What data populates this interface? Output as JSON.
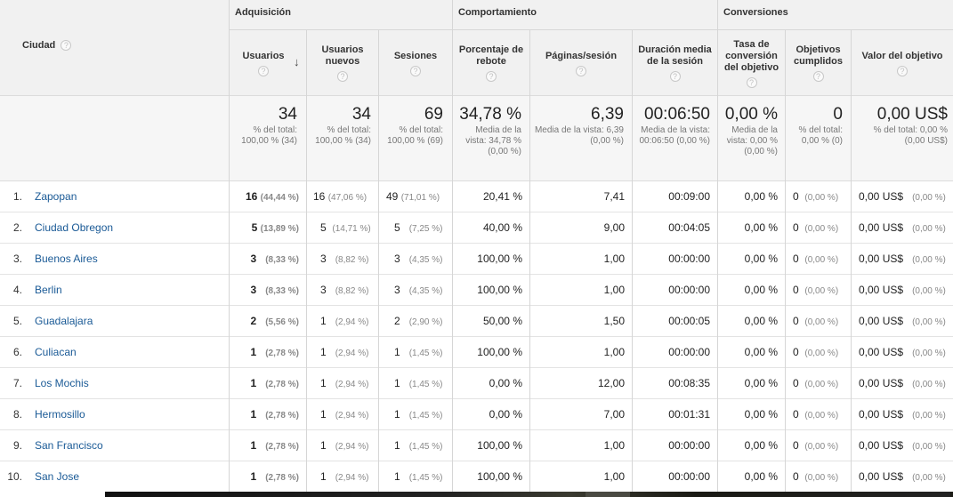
{
  "header": {
    "city_label": "Ciudad",
    "help_glyph": "?",
    "groups": [
      {
        "label": "Adquisición"
      },
      {
        "label": "Comportamiento"
      },
      {
        "label": "Conversiones"
      }
    ],
    "columns": [
      {
        "label": "Usuarios"
      },
      {
        "label": "Usuarios nuevos"
      },
      {
        "label": "Sesiones"
      },
      {
        "label": "Porcentaje de rebote"
      },
      {
        "label": "Páginas/sesión"
      },
      {
        "label": "Duración media de la sesión"
      },
      {
        "label": "Tasa de conversión del objetivo"
      },
      {
        "label": "Objetivos cumplidos"
      },
      {
        "label": "Valor del objetivo"
      }
    ],
    "sort_icon": "sort-down-arrow-icon"
  },
  "totals": [
    {
      "value": "34",
      "sub": "% del total: 100,00 % (34)"
    },
    {
      "value": "34",
      "sub": "% del total: 100,00 % (34)"
    },
    {
      "value": "69",
      "sub": "% del total: 100,00 % (69)"
    },
    {
      "value": "34,78 %",
      "sub": "Media de la vista: 34,78 % (0,00 %)"
    },
    {
      "value": "6,39",
      "sub": "Media de la vista: 6,39 (0,00 %)"
    },
    {
      "value": "00:06:50",
      "sub": "Media de la vista: 00:06:50 (0,00 %)"
    },
    {
      "value": "0,00 %",
      "sub": "Media de la vista: 0,00 % (0,00 %)"
    },
    {
      "value": "0",
      "sub": "% del total: 0,00 % (0)"
    },
    {
      "value": "0,00 US$",
      "sub": "% del total: 0,00 % (0,00 US$)"
    }
  ],
  "rows": [
    {
      "n": "1.",
      "city": "Zapopan",
      "users": "16",
      "users_pct": "(44,44 %)",
      "new_users": "16",
      "new_users_pct": "(47,06 %)",
      "sessions": "49",
      "sessions_pct": "(71,01 %)",
      "bounce": "20,41 %",
      "pages": "7,41",
      "duration": "00:09:00",
      "conv": "0,00 %",
      "goals": "0",
      "goals_pct": "(0,00 %)",
      "value": "0,00 US$",
      "value_pct": "(0,00 %)"
    },
    {
      "n": "2.",
      "city": "Ciudad Obregon",
      "users": "5",
      "users_pct": "(13,89 %)",
      "new_users": "5",
      "new_users_pct": "(14,71 %)",
      "sessions": "5",
      "sessions_pct": "(7,25 %)",
      "bounce": "40,00 %",
      "pages": "9,00",
      "duration": "00:04:05",
      "conv": "0,00 %",
      "goals": "0",
      "goals_pct": "(0,00 %)",
      "value": "0,00 US$",
      "value_pct": "(0,00 %)"
    },
    {
      "n": "3.",
      "city": "Buenos Aires",
      "users": "3",
      "users_pct": "(8,33 %)",
      "new_users": "3",
      "new_users_pct": "(8,82 %)",
      "sessions": "3",
      "sessions_pct": "(4,35 %)",
      "bounce": "100,00 %",
      "pages": "1,00",
      "duration": "00:00:00",
      "conv": "0,00 %",
      "goals": "0",
      "goals_pct": "(0,00 %)",
      "value": "0,00 US$",
      "value_pct": "(0,00 %)"
    },
    {
      "n": "4.",
      "city": "Berlin",
      "users": "3",
      "users_pct": "(8,33 %)",
      "new_users": "3",
      "new_users_pct": "(8,82 %)",
      "sessions": "3",
      "sessions_pct": "(4,35 %)",
      "bounce": "100,00 %",
      "pages": "1,00",
      "duration": "00:00:00",
      "conv": "0,00 %",
      "goals": "0",
      "goals_pct": "(0,00 %)",
      "value": "0,00 US$",
      "value_pct": "(0,00 %)"
    },
    {
      "n": "5.",
      "city": "Guadalajara",
      "users": "2",
      "users_pct": "(5,56 %)",
      "new_users": "1",
      "new_users_pct": "(2,94 %)",
      "sessions": "2",
      "sessions_pct": "(2,90 %)",
      "bounce": "50,00 %",
      "pages": "1,50",
      "duration": "00:00:05",
      "conv": "0,00 %",
      "goals": "0",
      "goals_pct": "(0,00 %)",
      "value": "0,00 US$",
      "value_pct": "(0,00 %)"
    },
    {
      "n": "6.",
      "city": "Culiacan",
      "users": "1",
      "users_pct": "(2,78 %)",
      "new_users": "1",
      "new_users_pct": "(2,94 %)",
      "sessions": "1",
      "sessions_pct": "(1,45 %)",
      "bounce": "100,00 %",
      "pages": "1,00",
      "duration": "00:00:00",
      "conv": "0,00 %",
      "goals": "0",
      "goals_pct": "(0,00 %)",
      "value": "0,00 US$",
      "value_pct": "(0,00 %)"
    },
    {
      "n": "7.",
      "city": "Los Mochis",
      "users": "1",
      "users_pct": "(2,78 %)",
      "new_users": "1",
      "new_users_pct": "(2,94 %)",
      "sessions": "1",
      "sessions_pct": "(1,45 %)",
      "bounce": "0,00 %",
      "pages": "12,00",
      "duration": "00:08:35",
      "conv": "0,00 %",
      "goals": "0",
      "goals_pct": "(0,00 %)",
      "value": "0,00 US$",
      "value_pct": "(0,00 %)"
    },
    {
      "n": "8.",
      "city": "Hermosillo",
      "users": "1",
      "users_pct": "(2,78 %)",
      "new_users": "1",
      "new_users_pct": "(2,94 %)",
      "sessions": "1",
      "sessions_pct": "(1,45 %)",
      "bounce": "0,00 %",
      "pages": "7,00",
      "duration": "00:01:31",
      "conv": "0,00 %",
      "goals": "0",
      "goals_pct": "(0,00 %)",
      "value": "0,00 US$",
      "value_pct": "(0,00 %)"
    },
    {
      "n": "9.",
      "city": "San Francisco",
      "users": "1",
      "users_pct": "(2,78 %)",
      "new_users": "1",
      "new_users_pct": "(2,94 %)",
      "sessions": "1",
      "sessions_pct": "(1,45 %)",
      "bounce": "100,00 %",
      "pages": "1,00",
      "duration": "00:00:00",
      "conv": "0,00 %",
      "goals": "0",
      "goals_pct": "(0,00 %)",
      "value": "0,00 US$",
      "value_pct": "(0,00 %)"
    },
    {
      "n": "10.",
      "city": "San Jose",
      "users": "1",
      "users_pct": "(2,78 %)",
      "new_users": "1",
      "new_users_pct": "(2,94 %)",
      "sessions": "1",
      "sessions_pct": "(1,45 %)",
      "bounce": "100,00 %",
      "pages": "1,00",
      "duration": "00:00:00",
      "conv": "0,00 %",
      "goals": "0",
      "goals_pct": "(0,00 %)",
      "value": "0,00 US$",
      "value_pct": "(0,00 %)"
    }
  ]
}
